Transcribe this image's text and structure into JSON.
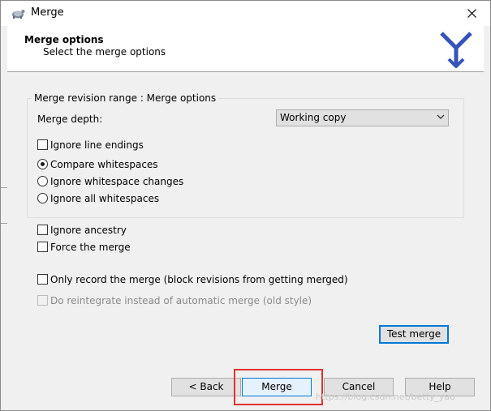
{
  "window": {
    "title": "Merge",
    "close_glyph": "✕"
  },
  "header": {
    "title": "Merge options",
    "subtitle": "Select the merge options"
  },
  "group": {
    "legend": "Merge revision range : Merge options",
    "merge_depth_label": "Merge depth:",
    "merge_depth_value": "Working copy",
    "ignore_line_endings": "Ignore line endings",
    "whitespace_options": [
      {
        "label": "Compare whitespaces",
        "checked": true
      },
      {
        "label": "Ignore whitespace changes",
        "checked": false
      },
      {
        "label": "Ignore all whitespaces",
        "checked": false
      }
    ]
  },
  "options": {
    "ignore_ancestry": "Ignore ancestry",
    "force_merge": "Force the merge",
    "only_record": "Only record the merge (block revisions from getting merged)",
    "reintegrate": "Do reintegrate instead of automatic merge (old style)"
  },
  "buttons": {
    "test_merge": "Test merge",
    "back": "< Back",
    "merge": "Merge",
    "cancel": "Cancel",
    "help": "Help"
  },
  "watermark": "https://blog.csdn.net/betty_yao",
  "colors": {
    "highlight_box": "#e0322f",
    "focus_blue": "#0078d7",
    "logo_blue": "#3553b8"
  }
}
